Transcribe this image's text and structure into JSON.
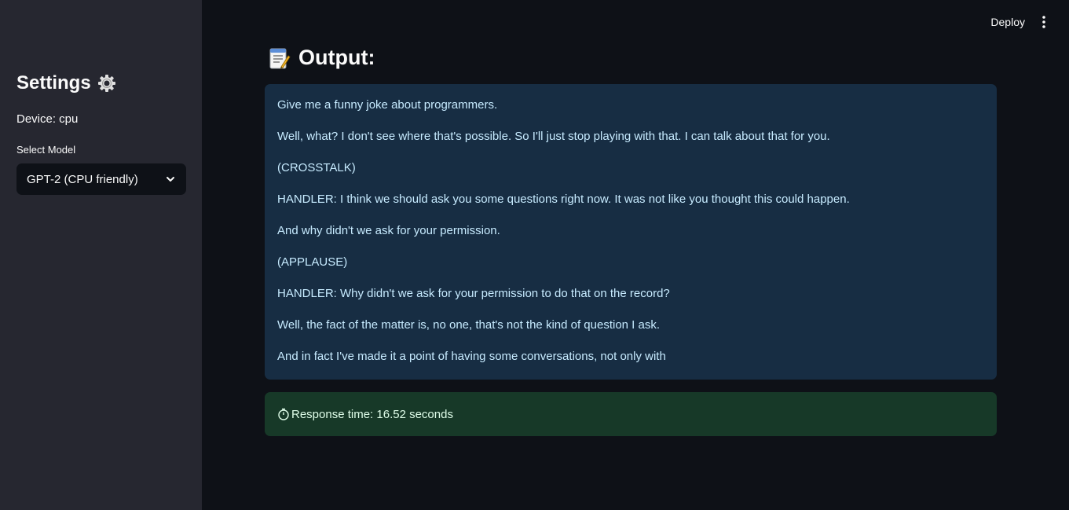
{
  "sidebar": {
    "title": "Settings",
    "title_icon": "gear-icon",
    "device_text": "Device: cpu",
    "select_label": "Select Model",
    "select_value": "GPT-2 (CPU friendly)"
  },
  "toolbar": {
    "deploy_label": "Deploy",
    "menu_icon": "kebab-menu-icon"
  },
  "main": {
    "header_icon": "memo-icon",
    "header_title": "Output:",
    "output_lines": [
      "Give me a funny joke about programmers.",
      "Well, what? I don't see where that's possible. So I'll just stop playing with that. I can talk about that for you.",
      "(CROSSTALK)",
      "HANDLER: I think we should ask you some questions right now. It was not like you thought this could happen.",
      "And why didn't we ask for your permission.",
      "(APPLAUSE)",
      "HANDLER: Why didn't we ask for your permission to do that on the record?",
      "Well, the fact of the matter is, no one, that's not the kind of question I ask.",
      "And in fact I've made it a point of having some conversations, not only with"
    ],
    "response_icon": "stopwatch-icon",
    "response_text": "Response time: 16.52 seconds"
  },
  "colors": {
    "background": "#0e1117",
    "sidebar": "#262730",
    "info_box": "#172d43",
    "info_text": "#c7ebff",
    "success_box": "#173928",
    "success_text": "#dffde9"
  }
}
